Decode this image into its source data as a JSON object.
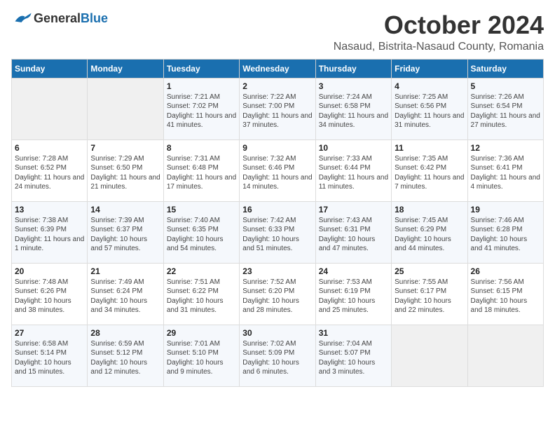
{
  "header": {
    "logo_general": "General",
    "logo_blue": "Blue",
    "month": "October 2024",
    "location": "Nasaud, Bistrita-Nasaud County, Romania"
  },
  "days_of_week": [
    "Sunday",
    "Monday",
    "Tuesday",
    "Wednesday",
    "Thursday",
    "Friday",
    "Saturday"
  ],
  "weeks": [
    [
      {
        "day": "",
        "info": ""
      },
      {
        "day": "",
        "info": ""
      },
      {
        "day": "1",
        "sunrise": "Sunrise: 7:21 AM",
        "sunset": "Sunset: 7:02 PM",
        "daylight": "Daylight: 11 hours and 41 minutes."
      },
      {
        "day": "2",
        "sunrise": "Sunrise: 7:22 AM",
        "sunset": "Sunset: 7:00 PM",
        "daylight": "Daylight: 11 hours and 37 minutes."
      },
      {
        "day": "3",
        "sunrise": "Sunrise: 7:24 AM",
        "sunset": "Sunset: 6:58 PM",
        "daylight": "Daylight: 11 hours and 34 minutes."
      },
      {
        "day": "4",
        "sunrise": "Sunrise: 7:25 AM",
        "sunset": "Sunset: 6:56 PM",
        "daylight": "Daylight: 11 hours and 31 minutes."
      },
      {
        "day": "5",
        "sunrise": "Sunrise: 7:26 AM",
        "sunset": "Sunset: 6:54 PM",
        "daylight": "Daylight: 11 hours and 27 minutes."
      }
    ],
    [
      {
        "day": "6",
        "sunrise": "Sunrise: 7:28 AM",
        "sunset": "Sunset: 6:52 PM",
        "daylight": "Daylight: 11 hours and 24 minutes."
      },
      {
        "day": "7",
        "sunrise": "Sunrise: 7:29 AM",
        "sunset": "Sunset: 6:50 PM",
        "daylight": "Daylight: 11 hours and 21 minutes."
      },
      {
        "day": "8",
        "sunrise": "Sunrise: 7:31 AM",
        "sunset": "Sunset: 6:48 PM",
        "daylight": "Daylight: 11 hours and 17 minutes."
      },
      {
        "day": "9",
        "sunrise": "Sunrise: 7:32 AM",
        "sunset": "Sunset: 6:46 PM",
        "daylight": "Daylight: 11 hours and 14 minutes."
      },
      {
        "day": "10",
        "sunrise": "Sunrise: 7:33 AM",
        "sunset": "Sunset: 6:44 PM",
        "daylight": "Daylight: 11 hours and 11 minutes."
      },
      {
        "day": "11",
        "sunrise": "Sunrise: 7:35 AM",
        "sunset": "Sunset: 6:42 PM",
        "daylight": "Daylight: 11 hours and 7 minutes."
      },
      {
        "day": "12",
        "sunrise": "Sunrise: 7:36 AM",
        "sunset": "Sunset: 6:41 PM",
        "daylight": "Daylight: 11 hours and 4 minutes."
      }
    ],
    [
      {
        "day": "13",
        "sunrise": "Sunrise: 7:38 AM",
        "sunset": "Sunset: 6:39 PM",
        "daylight": "Daylight: 11 hours and 1 minute."
      },
      {
        "day": "14",
        "sunrise": "Sunrise: 7:39 AM",
        "sunset": "Sunset: 6:37 PM",
        "daylight": "Daylight: 10 hours and 57 minutes."
      },
      {
        "day": "15",
        "sunrise": "Sunrise: 7:40 AM",
        "sunset": "Sunset: 6:35 PM",
        "daylight": "Daylight: 10 hours and 54 minutes."
      },
      {
        "day": "16",
        "sunrise": "Sunrise: 7:42 AM",
        "sunset": "Sunset: 6:33 PM",
        "daylight": "Daylight: 10 hours and 51 minutes."
      },
      {
        "day": "17",
        "sunrise": "Sunrise: 7:43 AM",
        "sunset": "Sunset: 6:31 PM",
        "daylight": "Daylight: 10 hours and 47 minutes."
      },
      {
        "day": "18",
        "sunrise": "Sunrise: 7:45 AM",
        "sunset": "Sunset: 6:29 PM",
        "daylight": "Daylight: 10 hours and 44 minutes."
      },
      {
        "day": "19",
        "sunrise": "Sunrise: 7:46 AM",
        "sunset": "Sunset: 6:28 PM",
        "daylight": "Daylight: 10 hours and 41 minutes."
      }
    ],
    [
      {
        "day": "20",
        "sunrise": "Sunrise: 7:48 AM",
        "sunset": "Sunset: 6:26 PM",
        "daylight": "Daylight: 10 hours and 38 minutes."
      },
      {
        "day": "21",
        "sunrise": "Sunrise: 7:49 AM",
        "sunset": "Sunset: 6:24 PM",
        "daylight": "Daylight: 10 hours and 34 minutes."
      },
      {
        "day": "22",
        "sunrise": "Sunrise: 7:51 AM",
        "sunset": "Sunset: 6:22 PM",
        "daylight": "Daylight: 10 hours and 31 minutes."
      },
      {
        "day": "23",
        "sunrise": "Sunrise: 7:52 AM",
        "sunset": "Sunset: 6:20 PM",
        "daylight": "Daylight: 10 hours and 28 minutes."
      },
      {
        "day": "24",
        "sunrise": "Sunrise: 7:53 AM",
        "sunset": "Sunset: 6:19 PM",
        "daylight": "Daylight: 10 hours and 25 minutes."
      },
      {
        "day": "25",
        "sunrise": "Sunrise: 7:55 AM",
        "sunset": "Sunset: 6:17 PM",
        "daylight": "Daylight: 10 hours and 22 minutes."
      },
      {
        "day": "26",
        "sunrise": "Sunrise: 7:56 AM",
        "sunset": "Sunset: 6:15 PM",
        "daylight": "Daylight: 10 hours and 18 minutes."
      }
    ],
    [
      {
        "day": "27",
        "sunrise": "Sunrise: 6:58 AM",
        "sunset": "Sunset: 5:14 PM",
        "daylight": "Daylight: 10 hours and 15 minutes."
      },
      {
        "day": "28",
        "sunrise": "Sunrise: 6:59 AM",
        "sunset": "Sunset: 5:12 PM",
        "daylight": "Daylight: 10 hours and 12 minutes."
      },
      {
        "day": "29",
        "sunrise": "Sunrise: 7:01 AM",
        "sunset": "Sunset: 5:10 PM",
        "daylight": "Daylight: 10 hours and 9 minutes."
      },
      {
        "day": "30",
        "sunrise": "Sunrise: 7:02 AM",
        "sunset": "Sunset: 5:09 PM",
        "daylight": "Daylight: 10 hours and 6 minutes."
      },
      {
        "day": "31",
        "sunrise": "Sunrise: 7:04 AM",
        "sunset": "Sunset: 5:07 PM",
        "daylight": "Daylight: 10 hours and 3 minutes."
      },
      {
        "day": "",
        "info": ""
      },
      {
        "day": "",
        "info": ""
      }
    ]
  ]
}
